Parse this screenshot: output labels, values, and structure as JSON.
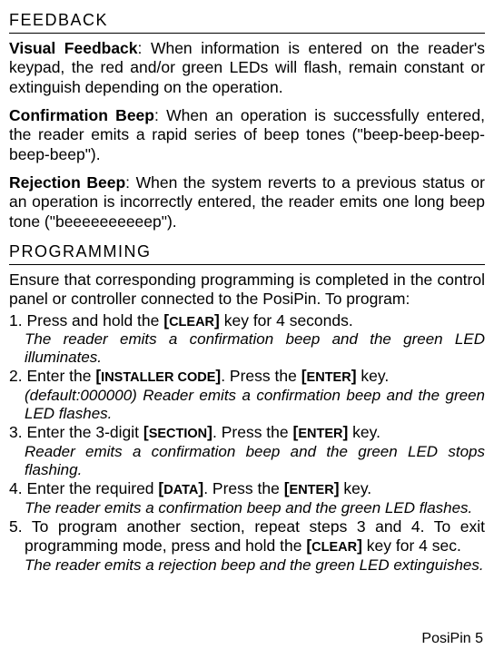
{
  "section1": {
    "heading": "FEEDBACK",
    "para1_bold": "Visual Feedback",
    "para1_rest": ": When information is entered on the reader's keypad, the red and/or green LEDs will flash, remain constant or extinguish depending on the operation.",
    "para2_bold": "Confirmation Beep",
    "para2_rest": ": When an operation is successfully entered, the reader emits a rapid series of beep tones (\"beep-beep-beep-beep-beep\").",
    "para3_bold": "Rejection Beep",
    "para3_rest": ": When the system reverts to a previous status or an operation is incorrectly entered, the reader emits one long beep tone (\"beeeeeeeeeep\")."
  },
  "section2": {
    "heading": "PROGRAMMING",
    "intro": "Ensure that corresponding programming is completed in the control panel or controller connected to the PosiPin. To program:",
    "step1_a": "1. Press and hold the ",
    "step1_key_br1": "[",
    "step1_key_txt": "CLEAR",
    "step1_key_br2": "]",
    "step1_b": " key for 4 seconds.",
    "step1_note": "The reader emits a confirmation beep and the green LED illuminates.",
    "step2_a": "2. Enter the ",
    "step2_key1_br1": "[",
    "step2_key1_txt": "INSTALLER CODE",
    "step2_key1_br2": "]",
    "step2_b": ". Press the ",
    "step2_key2_br1": "[",
    "step2_key2_txt": "ENTER",
    "step2_key2_br2": "]",
    "step2_c": " key.",
    "step2_note": "(default:000000) Reader emits a confirmation beep and the green LED flashes.",
    "step3_a": "3. Enter the 3-digit ",
    "step3_key1_br1": "[",
    "step3_key1_txt": "SECTION",
    "step3_key1_br2": "]",
    "step3_b": ". Press the ",
    "step3_key2_br1": "[",
    "step3_key2_txt": "ENTER",
    "step3_key2_br2": "]",
    "step3_c": " key.",
    "step3_note": "Reader emits a confirmation beep and the green LED stops flashing.",
    "step4_a": "4. Enter the required ",
    "step4_key1_br1": "[",
    "step4_key1_txt": "DATA",
    "step4_key1_br2": "]",
    "step4_b": ". Press the ",
    "step4_key2_br1": "[",
    "step4_key2_txt": "ENTER",
    "step4_key2_br2": "]",
    "step4_c": " key.",
    "step4_note": "The reader emits a confirmation beep and the green LED flashes.",
    "step5_a": "5. To program another section, repeat steps 3 and 4. To exit programming mode, press and hold the ",
    "step5_key_br1": "[",
    "step5_key_txt": "CLEAR",
    "step5_key_br2": "]",
    "step5_b": " key for 4 sec.",
    "step5_note": "The reader emits a rejection beep and the green LED extinguishes."
  },
  "footer": "PosiPin 5"
}
